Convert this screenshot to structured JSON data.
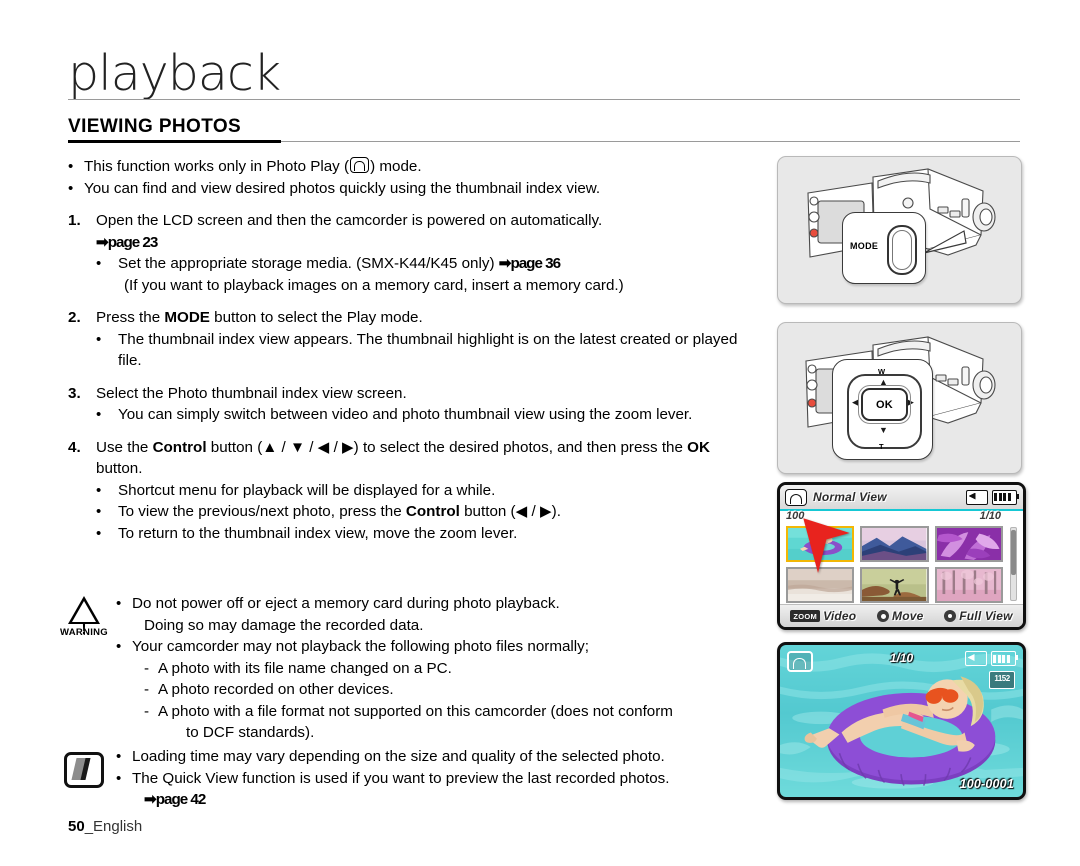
{
  "chapter": {
    "title": "playback"
  },
  "section": {
    "heading": "VIEWING PHOTOS"
  },
  "intro": {
    "bullet1_a": "This function works only in Photo Play (",
    "bullet1_b": ") mode.",
    "bullet2": "You can find and view desired photos quickly using the thumbnail index view."
  },
  "steps": [
    {
      "number": "1.",
      "text": "Open the LCD screen and then the camcorder is powered on automatically.",
      "ref": "➡page 23",
      "sub": [
        {
          "text_a": "Set the appropriate storage media. (SMX-K44/K45 only) ",
          "ref": "➡page 36"
        },
        {
          "text_a": "(If you want to playback images on a memory card, insert a memory card.)"
        }
      ]
    },
    {
      "number": "2.",
      "text_a": "Press the ",
      "bold": "MODE",
      "text_b": " button to select the Play mode.",
      "sub": [
        {
          "text_a": "The thumbnail index view appears. The thumbnail highlight is on the latest created or played file."
        }
      ]
    },
    {
      "number": "3.",
      "text": "Select the Photo thumbnail index view screen.",
      "sub": [
        {
          "text_a": "You can simply switch between video and photo thumbnail view using the zoom lever."
        }
      ]
    },
    {
      "number": "4.",
      "text_a": "Use the ",
      "bold": "Control",
      "text_b": " button (▲ / ▼ / ◀ / ▶) to select the desired photos, and then press the ",
      "bold2": "OK",
      "text_c": " button.",
      "sub": [
        {
          "text_a": "Shortcut menu for playback will be displayed for a while."
        },
        {
          "text_a": "To view the previous/next photo, press the ",
          "bold": "Control",
          "text_b": " button (◀ / ▶)."
        },
        {
          "text_a": "To return to the thumbnail index view, move the zoom lever."
        }
      ]
    }
  ],
  "warning": {
    "label": "WARNING",
    "items": [
      "Do not power off or eject a memory card during photo playback.",
      "Doing so may damage the recorded data.",
      "Your camcorder may not playback the following photo files normally;"
    ],
    "dashes": [
      "A photo with its file name changed on a PC.",
      "A photo recorded on other devices.",
      "A photo with a file format not supported on this camcorder (does not conform",
      "to DCF standards)."
    ]
  },
  "note": {
    "items": [
      "Loading time may vary depending on the size and quality of the selected photo.",
      "The Quick View function is used if you want to preview the last recorded photos."
    ],
    "ref": "➡page 42"
  },
  "footer": {
    "page": "50",
    "language": "_English"
  },
  "panels": {
    "mode_panel": {
      "button_label": "MODE"
    },
    "control_panel": {
      "ok_label": "OK",
      "zoom_wide": "W",
      "zoom_tele": "T",
      "up": "▲",
      "down": "▼",
      "left": "◀",
      "right": "▶"
    }
  },
  "lcd_thumbnail": {
    "title": "Normal View",
    "folder": "100",
    "page": "1/10",
    "bottom": {
      "zoom_chip": "ZOOM",
      "zoom_label": "Video",
      "move_label": "Move",
      "full_label": "Full View"
    },
    "thumbnails": [
      {
        "name": "pool-float",
        "selected": true
      },
      {
        "name": "mountains",
        "selected": false
      },
      {
        "name": "purple-leaves",
        "selected": false
      },
      {
        "name": "pale-field",
        "selected": false
      },
      {
        "name": "person-on-rock",
        "selected": false
      },
      {
        "name": "pink-forest",
        "selected": false
      }
    ]
  },
  "lcd_full": {
    "page": "1/10",
    "resolution_badge": "1152",
    "file_number": "100-0001"
  },
  "colors": {
    "highlight": "#f2b705",
    "lcd_accent": "#16c8d4",
    "cursor": "#e8231e",
    "panel_bg": "#e8e8e8"
  }
}
